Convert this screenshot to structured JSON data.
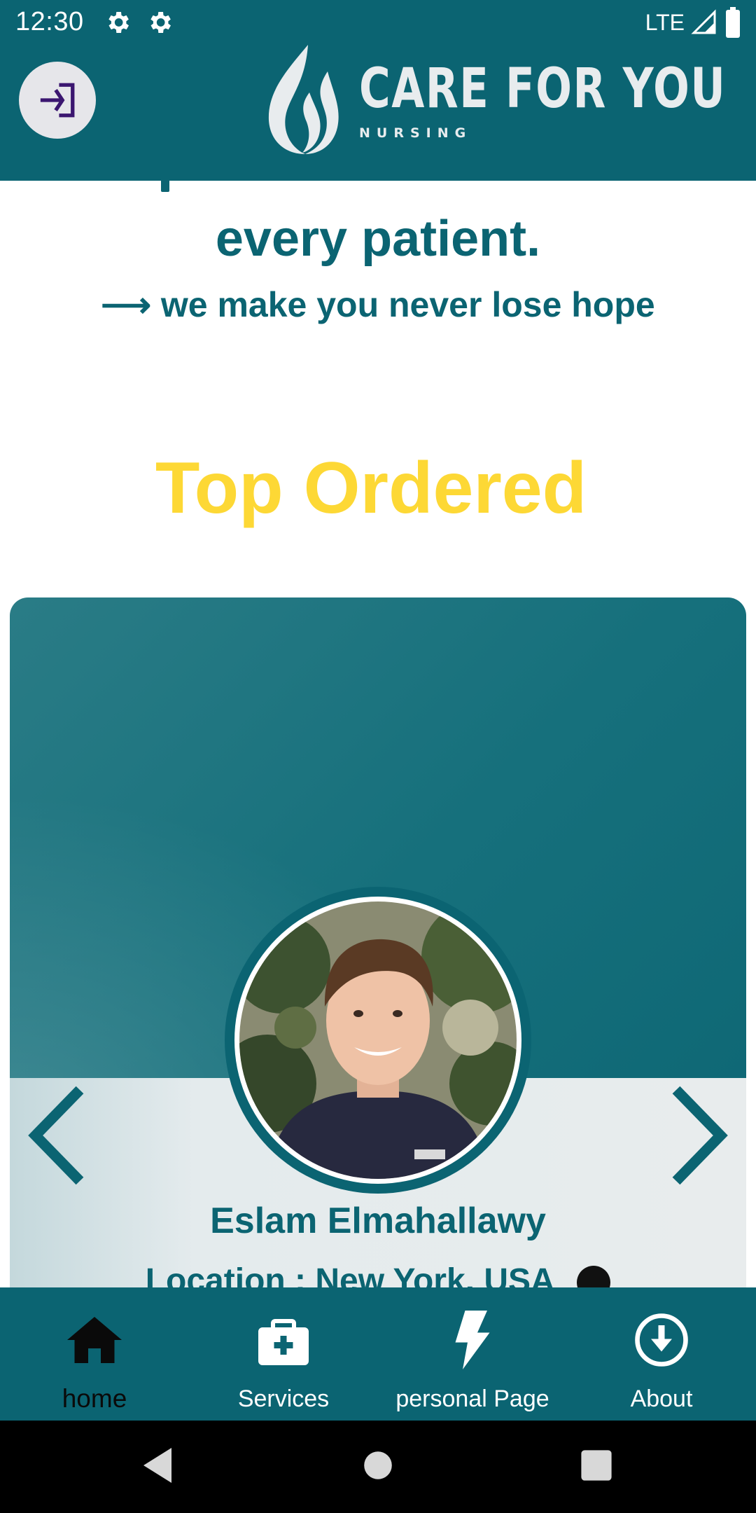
{
  "status_bar": {
    "time": "12:30",
    "network": "LTE",
    "icons": [
      "gear-icon",
      "gear-icon",
      "signal-icon",
      "battery-icon"
    ]
  },
  "header": {
    "login_icon": "login-icon",
    "logo_title": "CARE FOR YOU",
    "logo_subtitle": "NURSING"
  },
  "hero": {
    "line1": "every patient.",
    "line2": "⟶ we make you never lose hope"
  },
  "top_ordered": {
    "title": "Top Ordered",
    "card": {
      "name": "Eslam Elmahallawy",
      "location": "Location : New York, USA",
      "prev_icon": "chevron-left-icon",
      "next_icon": "chevron-right-icon"
    }
  },
  "bottom_nav": {
    "items": [
      {
        "label": "home",
        "icon": "home-icon",
        "active": true
      },
      {
        "label": "Services",
        "icon": "medical-kit-icon",
        "active": false
      },
      {
        "label": "personal Page",
        "icon": "lightning-icon",
        "active": false
      },
      {
        "label": "About",
        "icon": "download-circle-icon",
        "active": false
      }
    ]
  },
  "colors": {
    "primary": "#0b6472",
    "accent": "#fdd835",
    "card_bottom": "#e8eced"
  }
}
